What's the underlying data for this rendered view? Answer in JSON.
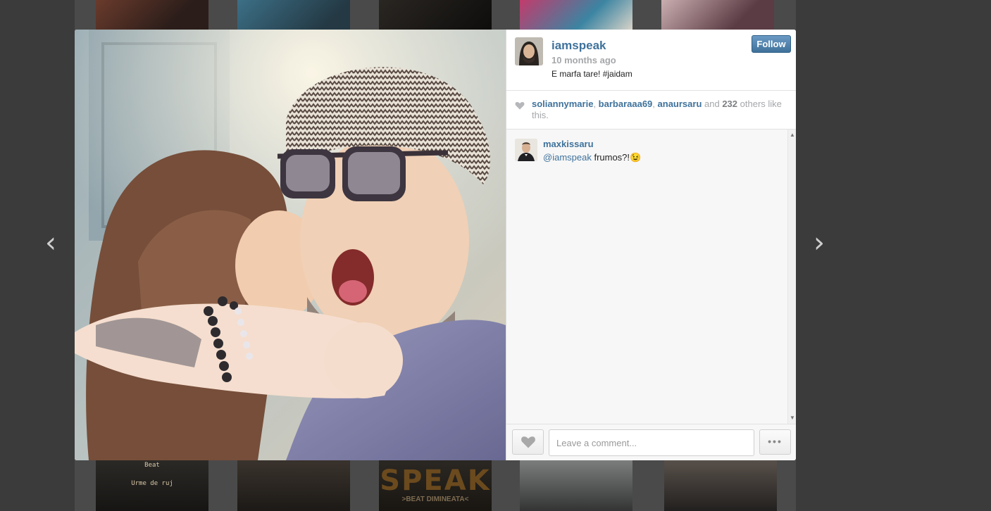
{
  "post": {
    "username": "iamspeak",
    "time_ago": "10 months ago",
    "caption": "E marfa tare! #jaidam",
    "follow_label": "Follow"
  },
  "likes": {
    "users": [
      "soliannymarie",
      "barbaraaa69",
      "anaursaru"
    ],
    "sep1": ", ",
    "sep2": ", ",
    "and_text": " and ",
    "others_count": "232",
    "others_text": " others like this."
  },
  "comments": [
    {
      "username": "maxkissaru",
      "mention": "@iamspeak",
      "text": " frumos?!😉"
    }
  ],
  "comment_box": {
    "placeholder": "Leave a comment..."
  },
  "more_label": "•••",
  "navigation": {
    "prev_icon": "‹",
    "next_icon": "›"
  },
  "background_thumbnails": {
    "bottom_1_lines": [
      "Beat",
      "Urme de ruj"
    ],
    "bottom_3_title": "SPEAK",
    "bottom_3_subtitle": ">BEAT DIMINEATA<"
  },
  "colors": {
    "link_blue": "#3f729b",
    "muted_gray": "#a5a7aa",
    "follow_button": "#3f729b"
  }
}
